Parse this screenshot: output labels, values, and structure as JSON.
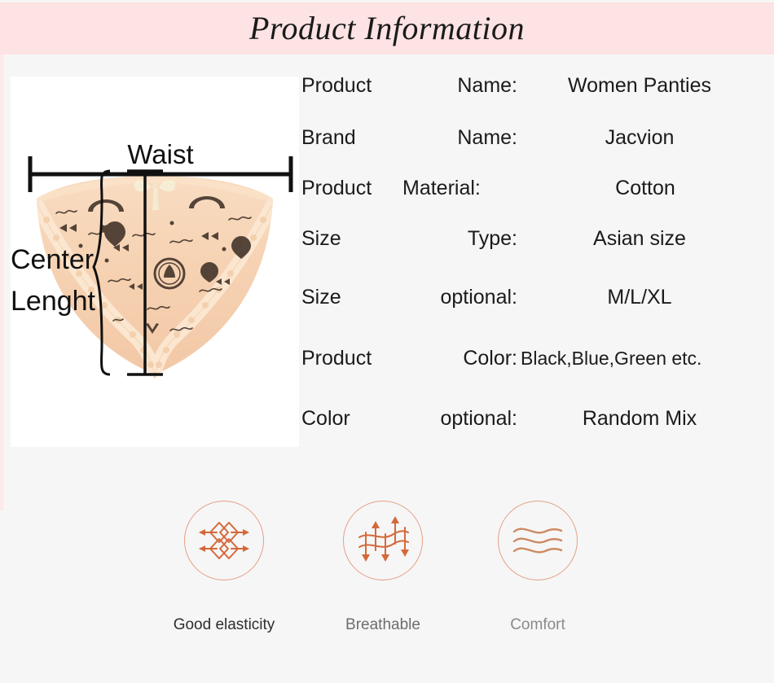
{
  "header": {
    "title": "Product Information",
    "background_color": "#fde3e3"
  },
  "product_image": {
    "alt": "Women panties with measurement guides",
    "garment_color": "#f6d4b6",
    "measurements": [
      {
        "name": "waist",
        "label": "Waist",
        "orientation": "horizontal"
      },
      {
        "name": "center-length",
        "label_line1": "Center",
        "label_line2": "Lenght",
        "orientation": "vertical"
      }
    ]
  },
  "specs": [
    {
      "key1": "Product",
      "key2": "Name:",
      "value": "Women Panties"
    },
    {
      "key1": "Brand",
      "key2": "Name:",
      "value": "Jacvion"
    },
    {
      "key1": "Product",
      "key2": "Material:",
      "value": "Cotton"
    },
    {
      "key1": "Size",
      "key2": "Type:",
      "value": "Asian size"
    },
    {
      "key1": "Size",
      "key2": "optional:",
      "value": "M/L/XL"
    },
    {
      "key1": "Product",
      "key2": "Color:",
      "value": "Black,Blue,Green etc."
    },
    {
      "key1": "Color",
      "key2": "optional:",
      "value": "Random Mix"
    }
  ],
  "features": [
    {
      "label": "Good elasticity",
      "icon": "stretch-arrows-icon",
      "accent": "#d4693a"
    },
    {
      "label": "Breathable",
      "icon": "airflow-arrows-icon",
      "accent": "#d4693a"
    },
    {
      "label": "Comfort",
      "icon": "wavy-lines-icon",
      "accent": "#cf8a62"
    }
  ]
}
